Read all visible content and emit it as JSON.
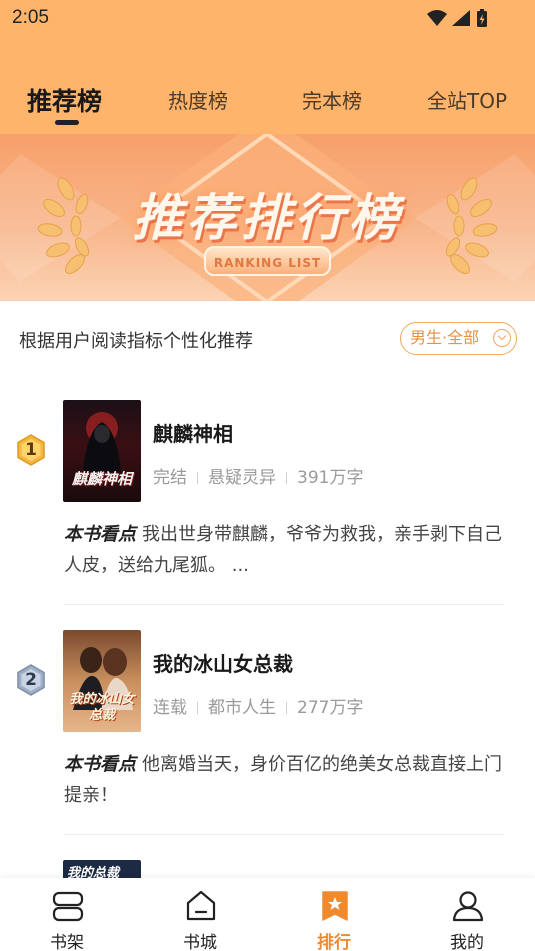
{
  "status_bar": {
    "time": "2:05"
  },
  "tabs": [
    {
      "label": "推荐榜",
      "active": true
    },
    {
      "label": "热度榜",
      "active": false
    },
    {
      "label": "完本榜",
      "active": false
    },
    {
      "label": "全站TOP",
      "active": false
    }
  ],
  "banner": {
    "title": "推荐排行榜",
    "ribbon": "RANKING LIST"
  },
  "subheader": {
    "text": "根据用户阅读指标个性化推荐",
    "filter_label": "男生·全部"
  },
  "books": [
    {
      "rank": "1",
      "title": "麒麟神相",
      "status": "完结",
      "genre": "悬疑灵异",
      "words": "391万字",
      "desc_label": "本书看点",
      "desc": "我出世身带麒麟，爷爷为救我，亲手剥下自己人皮，送给九尾狐。 ...",
      "cover_text": "麒麟神相"
    },
    {
      "rank": "2",
      "title": "我的冰山女总裁",
      "status": "连载",
      "genre": "都市人生",
      "words": "277万字",
      "desc_label": "本书看点",
      "desc": "他离婚当天，身价百亿的绝美女总裁直接上门提亲！",
      "cover_text": "我的冰山女总裁"
    },
    {
      "cover_text": "我的总裁"
    }
  ],
  "bottom_nav": [
    {
      "label": "书架",
      "icon": "bookshelf-icon",
      "active": false
    },
    {
      "label": "书城",
      "icon": "bookstore-icon",
      "active": false
    },
    {
      "label": "排行",
      "icon": "ranking-icon",
      "active": true
    },
    {
      "label": "我的",
      "icon": "profile-icon",
      "active": false
    }
  ],
  "colors": {
    "accent": "#f08a2e",
    "header_bg": "#ffb46b",
    "gold_badge": "#f3b640",
    "silver_badge": "#9fb0c6"
  }
}
